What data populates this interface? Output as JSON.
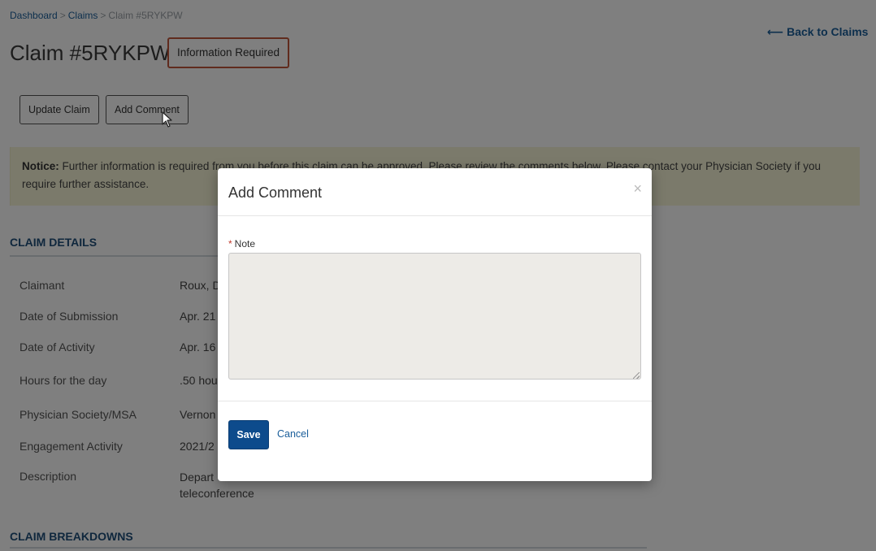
{
  "breadcrumb": {
    "items": [
      {
        "label": "Dashboard"
      },
      {
        "label": "Claims"
      },
      {
        "label": "Claim #5RYKPW"
      }
    ],
    "separator": ">"
  },
  "header": {
    "title": "Claim #5RYKPW",
    "status": "Information Required",
    "back_label": "Back to Claims"
  },
  "actions": {
    "update_label": "Update Claim",
    "add_comment_label": "Add Comment"
  },
  "notice": {
    "label": "Notice:",
    "text": "Further information is required from you before this claim can be approved. Please review the comments below. Please contact your Physician Society if you require further assistance."
  },
  "claim_details": {
    "title": "CLAIM DETAILS",
    "rows": [
      {
        "label": "Claimant",
        "value": "Roux, D"
      },
      {
        "label": "Date of Submission",
        "value": "Apr. 21"
      },
      {
        "label": "Date of Activity",
        "value": "Apr. 16"
      },
      {
        "label": "Hours for the day",
        "value": ".50 hou"
      },
      {
        "label": "Physician Society/MSA",
        "value": "Vernon"
      },
      {
        "label": "Engagement Activity",
        "value": "2021/2"
      },
      {
        "label": "Description",
        "value": "Depart",
        "value_line2": "teleconference"
      }
    ]
  },
  "claim_breakdowns": {
    "title": "CLAIM BREAKDOWNS"
  },
  "modal": {
    "title": "Add Comment",
    "close": "×",
    "note_label": "Note",
    "required_marker": "*",
    "note_value": "",
    "save_label": "Save",
    "cancel_label": "Cancel"
  },
  "icons": {
    "back": "arrow-left-icon",
    "close": "close-icon",
    "cursor": "mouse-pointer-icon"
  },
  "colors": {
    "primary": "#0d4b8c",
    "link": "#1a5e9a",
    "status_border": "#c0573b",
    "notice_bg": "#f6f5d6",
    "section_heading": "#1f4f7a"
  }
}
